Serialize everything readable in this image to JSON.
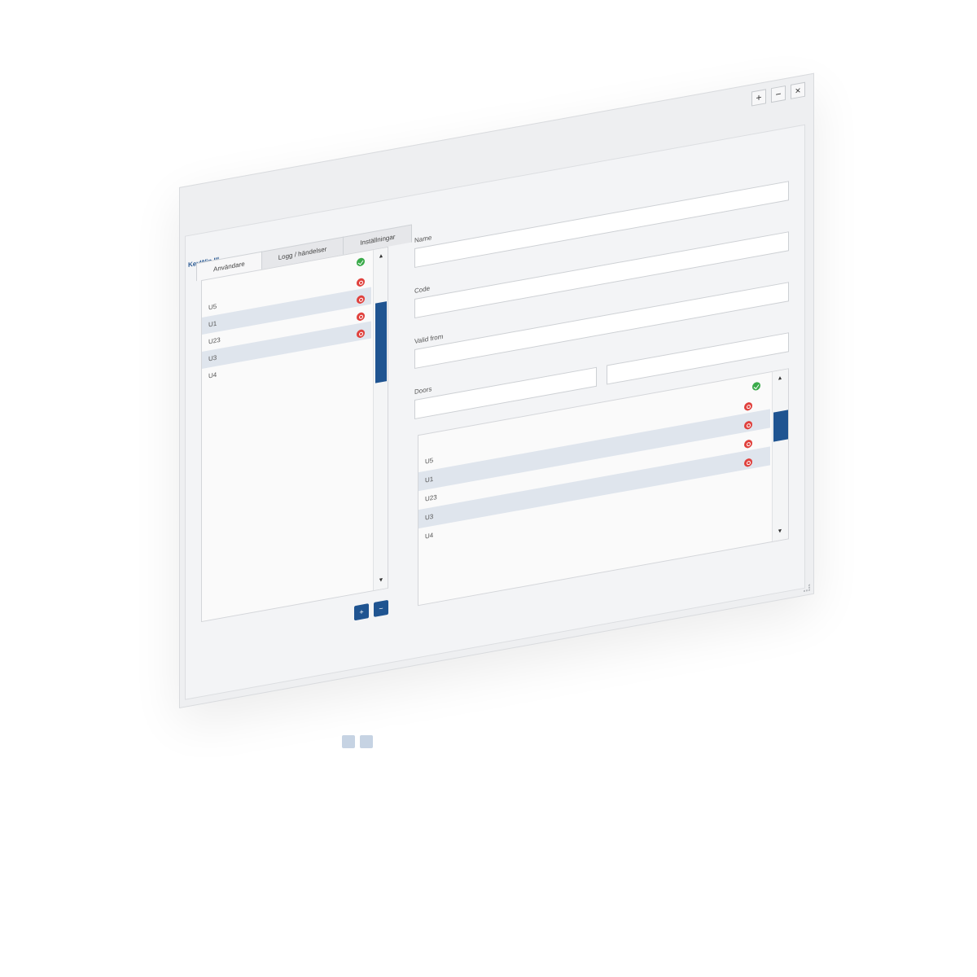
{
  "window": {
    "title": "KeyWin III",
    "controls": {
      "add": "+",
      "minimize": "−",
      "close": "×"
    }
  },
  "tabs": [
    {
      "label": "Användare",
      "active": true
    },
    {
      "label": "Logg / händelser",
      "active": false
    },
    {
      "label": "Inställningar",
      "active": false
    }
  ],
  "left_list": {
    "header_status": "ok",
    "rows": [
      {
        "label": "U5",
        "status": "err"
      },
      {
        "label": "U1",
        "status": "err"
      },
      {
        "label": "U23",
        "status": "err"
      },
      {
        "label": "U3",
        "status": "err"
      },
      {
        "label": "U4",
        "status": "none"
      }
    ],
    "scroll_up": "▲",
    "scroll_down": "▼"
  },
  "list_buttons": {
    "add": "+",
    "remove": "−"
  },
  "form": {
    "name_label": "Name",
    "name_value": "",
    "code_label": "Code",
    "code_value": "",
    "valid_from_label": "Valid from",
    "valid_from_value": "",
    "doors_label": "Doors",
    "doors_value_1": "",
    "doors_value_2": ""
  },
  "right_list": {
    "header_status": "ok",
    "rows": [
      {
        "label": "U5",
        "status": "err"
      },
      {
        "label": "U1",
        "status": "err"
      },
      {
        "label": "U23",
        "status": "err"
      },
      {
        "label": "U3",
        "status": "err"
      },
      {
        "label": "U4",
        "status": "none"
      }
    ],
    "scroll_up": "▲",
    "scroll_down": "▼"
  },
  "colors": {
    "accent": "#1f5491",
    "ok": "#3aaa4a",
    "error": "#e0413d",
    "row_highlight": "#dfe5ed"
  }
}
